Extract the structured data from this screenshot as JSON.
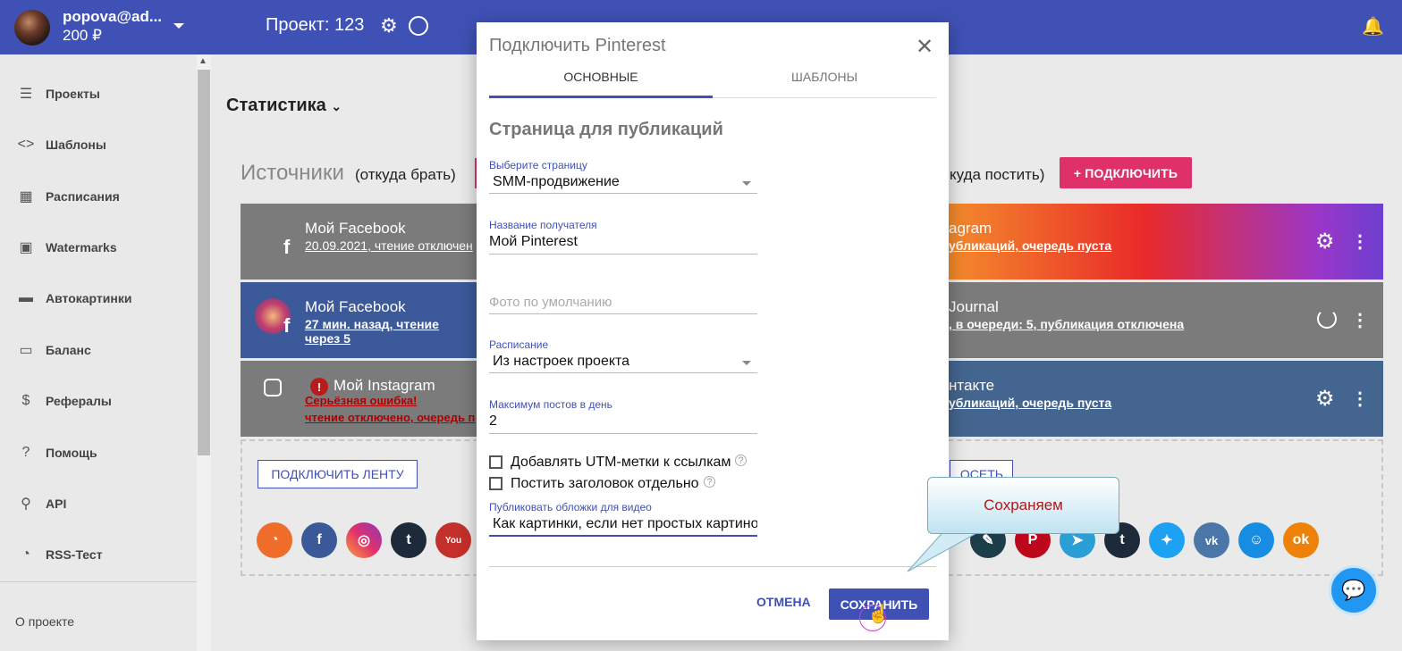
{
  "topbar": {
    "user_email": "popova@ad...",
    "balance": "200 ₽",
    "project_title": "Проект: 123"
  },
  "sidebar": {
    "items": [
      {
        "label": "Проекты",
        "icon": "list-icon"
      },
      {
        "label": "Шаблоны",
        "icon": "code-icon"
      },
      {
        "label": "Расписания",
        "icon": "calendar-icon"
      },
      {
        "label": "Watermarks",
        "icon": "image-icon"
      },
      {
        "label": "Автокартинки",
        "icon": "picture-text-icon"
      },
      {
        "label": "Баланс",
        "icon": "credit-card-icon"
      },
      {
        "label": "Рефералы",
        "icon": "dollar-icon"
      },
      {
        "label": "Помощь",
        "icon": "help-icon"
      },
      {
        "label": "API",
        "icon": "api-icon"
      },
      {
        "label": "RSS-Тест",
        "icon": "rss-icon"
      }
    ],
    "about": "О проекте"
  },
  "main": {
    "stats_title": "Статистика",
    "sources_title": "Источники",
    "sources_sub": "(откуда брать)",
    "targets_sub": "куда постить)",
    "connect_button": "+ ПОДКЛЮЧИТЬ",
    "feed_button": "ПОДКЛЮЧИТЬ ЛЕНТУ",
    "feed_button2": "ОСЕТЬ",
    "source_cards": [
      {
        "title": "Мой Facebook",
        "status": "20.09.2021, чтение отключен"
      },
      {
        "title": "Мой Facebook",
        "status": "27 мин. назад, чтение через 5"
      },
      {
        "title": "Мой Instagram",
        "status": "Серьёзная ошибка!",
        "status2": "чтение отключено, очередь п"
      }
    ],
    "target_cards": [
      {
        "title": "agram",
        "status": "убликаций, очередь пуста"
      },
      {
        "title": "Journal",
        "status": ", в очереди: 5, публикация отключена"
      },
      {
        "title": "нтакте",
        "status": "убликаций, очередь пуста"
      }
    ]
  },
  "modal": {
    "title": "Подключить Pinterest",
    "tabs": [
      "ОСНОВНЫЕ",
      "ШАБЛОНЫ"
    ],
    "section_title": "Страница для публикаций",
    "page_select_label": "Выберите страницу",
    "page_select_value": "SMM-продвижение",
    "recipient_label": "Название получателя",
    "recipient_value": "Мой Pinterest",
    "photo_placeholder": "Фото по умолчанию",
    "schedule_label": "Расписание",
    "schedule_value": "Из настроек проекта",
    "max_posts_label": "Максимум постов в день",
    "max_posts_value": "2",
    "utm_label": "Добавлять UTM-метки к ссылкам",
    "title_separately_label": "Постить заголовок отдельно",
    "video_cover_label": "Публиковать обложки для видео",
    "video_cover_value": "Как картинки, если нет простых картино",
    "cancel": "ОТМЕНА",
    "save": "СОХРАНИТЬ"
  },
  "callout": "Сохраняем",
  "colors": {
    "primary": "#3f51b5",
    "accent": "#e0306a"
  }
}
